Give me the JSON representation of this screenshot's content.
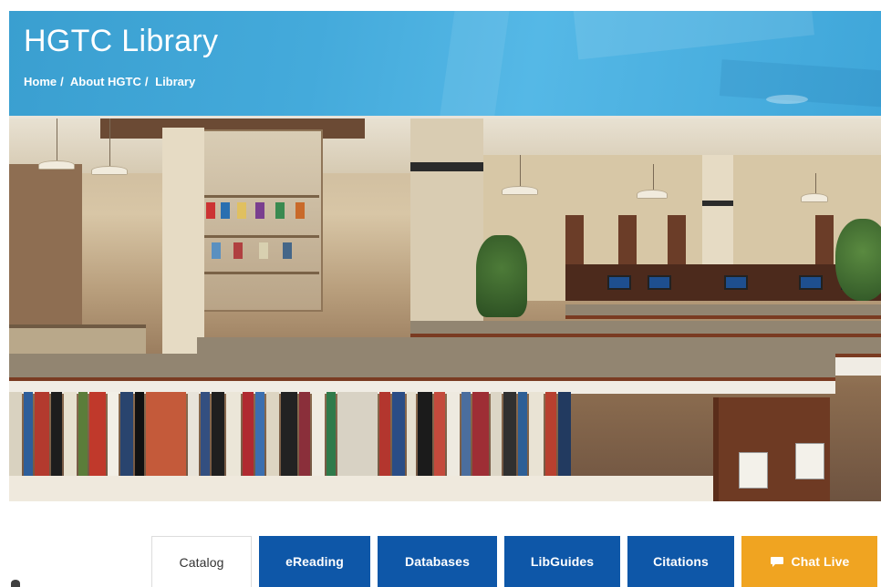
{
  "header": {
    "title": "HGTC Library",
    "breadcrumb": [
      {
        "label": "Home"
      },
      {
        "label": "About HGTC"
      },
      {
        "label": "Library"
      }
    ],
    "separator": "/",
    "banner_color": "#3fa6d9"
  },
  "hero_image": {
    "icon": "library-interior-photo"
  },
  "tabs": [
    {
      "label": "Catalog",
      "active": true
    },
    {
      "label": "eReading",
      "active": false
    },
    {
      "label": "Databases",
      "active": false
    },
    {
      "label": "LibGuides",
      "active": false
    },
    {
      "label": "Citations",
      "active": false
    },
    {
      "label": "Chat Live",
      "active": false,
      "icon": "chat-bubble-icon"
    }
  ],
  "colors": {
    "tab_blue": "#0e57a8",
    "chat_orange": "#f0a421",
    "active_tab_bg": "#ffffff"
  }
}
